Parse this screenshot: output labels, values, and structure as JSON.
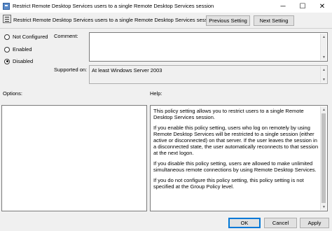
{
  "window": {
    "title": "Restrict Remote Desktop Services users to a single Remote Desktop Services session",
    "minimize_glyph": "─",
    "maximize_glyph": "☐",
    "close_glyph": "✕"
  },
  "header": {
    "setting_name": "Restrict Remote Desktop Services users to a single Remote Desktop Services session",
    "previous_label": "Previous Setting",
    "next_label": "Next Setting"
  },
  "state": {
    "options": [
      {
        "label": "Not Configured",
        "checked": false
      },
      {
        "label": "Enabled",
        "checked": false
      },
      {
        "label": "Disabled",
        "checked": true
      }
    ]
  },
  "comment": {
    "label": "Comment:",
    "value": ""
  },
  "supported": {
    "label": "Supported on:",
    "value": "At least Windows Server 2003"
  },
  "options_label": "Options:",
  "help": {
    "label": "Help:",
    "paragraphs": [
      "This policy setting allows you to restrict users to a single Remote Desktop Services session.",
      "If you enable this policy setting, users who log on remotely by using Remote Desktop Services will be restricted to a single session (either active or disconnected) on that server. If the user leaves the session in a disconnected state, the user automatically reconnects to that session at the next logon.",
      "If you disable this policy setting, users are allowed to make unlimited simultaneous remote connections by using Remote Desktop Services.",
      "If you do not configure this policy setting,  this policy setting is not specified at the Group Policy level."
    ]
  },
  "footer": {
    "ok": "OK",
    "cancel": "Cancel",
    "apply": "Apply"
  },
  "icons": {
    "app": "policy-settings-icon",
    "setting": "policy-document-icon"
  },
  "colors": {
    "accent": "#0078d7",
    "background": "#f0f0f0"
  }
}
